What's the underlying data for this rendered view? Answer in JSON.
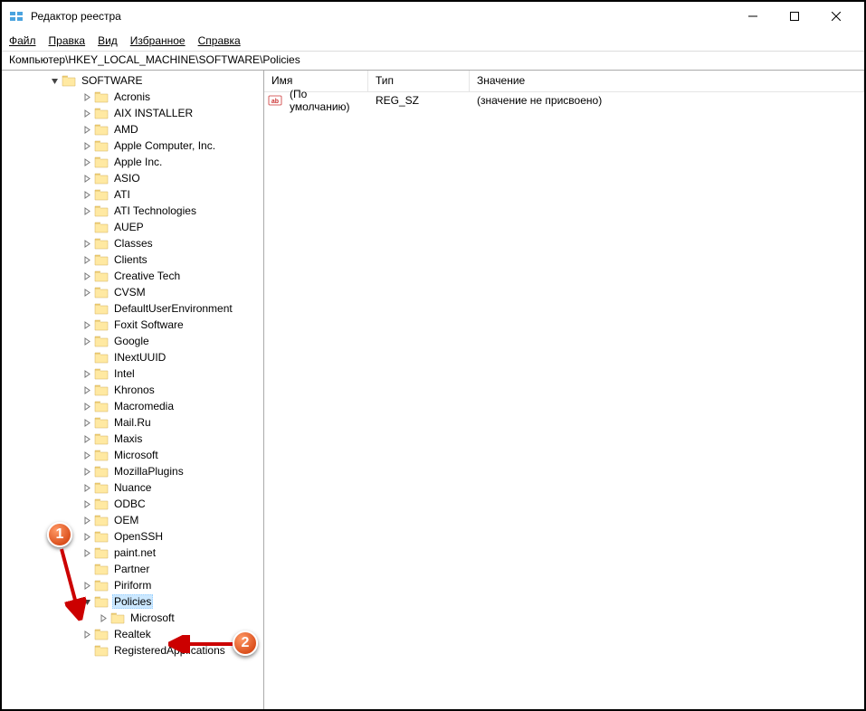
{
  "window": {
    "title": "Редактор реестра",
    "min": "−",
    "max": "□",
    "close": "✕"
  },
  "menu": {
    "file": "Файл",
    "edit": "Правка",
    "view": "Вид",
    "favorites": "Избранное",
    "help": "Справка"
  },
  "addressbar": "Компьютер\\HKEY_LOCAL_MACHINE\\SOFTWARE\\Policies",
  "tree": {
    "root": "SOFTWARE",
    "items": [
      {
        "label": "Acronis",
        "exp": ">"
      },
      {
        "label": "AIX INSTALLER",
        "exp": ">"
      },
      {
        "label": "AMD",
        "exp": ">"
      },
      {
        "label": "Apple Computer, Inc.",
        "exp": ">"
      },
      {
        "label": "Apple Inc.",
        "exp": ">"
      },
      {
        "label": "ASIO",
        "exp": ">"
      },
      {
        "label": "ATI",
        "exp": ">"
      },
      {
        "label": "ATI Technologies",
        "exp": ">"
      },
      {
        "label": "AUEP",
        "exp": ""
      },
      {
        "label": "Classes",
        "exp": ">"
      },
      {
        "label": "Clients",
        "exp": ">"
      },
      {
        "label": "Creative Tech",
        "exp": ">"
      },
      {
        "label": "CVSM",
        "exp": ">"
      },
      {
        "label": "DefaultUserEnvironment",
        "exp": ""
      },
      {
        "label": "Foxit Software",
        "exp": ">"
      },
      {
        "label": "Google",
        "exp": ">"
      },
      {
        "label": "INextUUID",
        "exp": ""
      },
      {
        "label": "Intel",
        "exp": ">"
      },
      {
        "label": "Khronos",
        "exp": ">"
      },
      {
        "label": "Macromedia",
        "exp": ">"
      },
      {
        "label": "Mail.Ru",
        "exp": ">"
      },
      {
        "label": "Maxis",
        "exp": ">"
      },
      {
        "label": "Microsoft",
        "exp": ">"
      },
      {
        "label": "MozillaPlugins",
        "exp": ">"
      },
      {
        "label": "Nuance",
        "exp": ">"
      },
      {
        "label": "ODBC",
        "exp": ">"
      },
      {
        "label": "OEM",
        "exp": ">"
      },
      {
        "label": "OpenSSH",
        "exp": ">"
      },
      {
        "label": "paint.net",
        "exp": ">"
      },
      {
        "label": "Partner",
        "exp": ""
      },
      {
        "label": "Piriform",
        "exp": ">"
      },
      {
        "label": "Policies",
        "exp": "v",
        "selected": true
      },
      {
        "label": "Microsoft",
        "exp": ">",
        "indent": 1
      },
      {
        "label": "Realtek",
        "exp": ">"
      },
      {
        "label": "RegisteredApplications",
        "exp": ""
      }
    ]
  },
  "list": {
    "headers": {
      "name": "Имя",
      "type": "Тип",
      "value": "Значение"
    },
    "rows": [
      {
        "name": "(По умолчанию)",
        "type": "REG_SZ",
        "value": "(значение не присвоено)"
      }
    ]
  },
  "annotations": {
    "a1": "1",
    "a2": "2"
  }
}
